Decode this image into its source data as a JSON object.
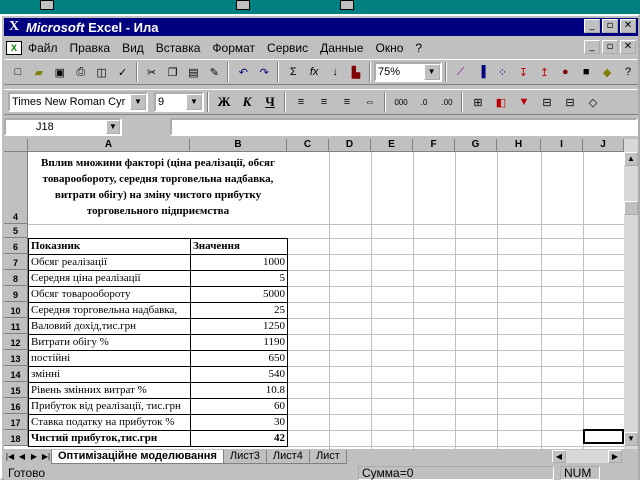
{
  "titlebar": {
    "app": "Microsoft",
    "rest": " Excel - Ила"
  },
  "menu": [
    "Файл",
    "Правка",
    "Вид",
    "Вставка",
    "Формат",
    "Сервис",
    "Данные",
    "Окно",
    "?"
  ],
  "toolbar": {
    "zoom": "75%"
  },
  "format_bar": {
    "font": "Times New Roman Cyr",
    "size": "9",
    "bold": "Ж",
    "italic": "К",
    "underline": "Ч"
  },
  "name_box": "J18",
  "columns": [
    "A",
    "B",
    "C",
    "D",
    "E",
    "F",
    "G",
    "H",
    "I",
    "J"
  ],
  "rows": [
    "4",
    "5",
    "6",
    "7",
    "8",
    "9",
    "10",
    "11",
    "12",
    "13",
    "14",
    "15",
    "16",
    "17",
    "18"
  ],
  "sheet": {
    "title": "Вплив множини факторі (ціна реалізації, обсяг товарообороту, середня торговельна надбавка, витрати обігу) на зміну чистого прибутку торговельного підприємства",
    "header": {
      "a": "Показник",
      "b": "Значення"
    },
    "table": [
      {
        "a": "Обсяг реалізації",
        "b": "1000"
      },
      {
        "a": "Середня ціна реалізації",
        "b": "5"
      },
      {
        "a": "Обсяг товарообороту",
        "b": "5000"
      },
      {
        "a": "Середня торговельна надбавка,",
        "b": "25"
      },
      {
        "a": "Валовий дохід,тис.грн",
        "b": "1250"
      },
      {
        "a": "Витрати обігу %",
        "b": "1190"
      },
      {
        "a": "постійні",
        "b": "650"
      },
      {
        "a": "змінні",
        "b": "540"
      },
      {
        "a": "Рівень змінних витрат %",
        "b": "10.8"
      },
      {
        "a": "Прибуток від реалізації, тис.грн",
        "b": "60"
      },
      {
        "a": "Ставка податку на прибуток %",
        "b": "30"
      },
      {
        "a": "Чистий прибуток,тис.грн",
        "b": "42"
      }
    ]
  },
  "tabs": [
    "Оптимізаційне моделювання",
    "Лист3",
    "Лист4",
    "Лист"
  ],
  "status": {
    "ready": "Готово",
    "sum": "Сумма=0",
    "num": "NUM"
  }
}
